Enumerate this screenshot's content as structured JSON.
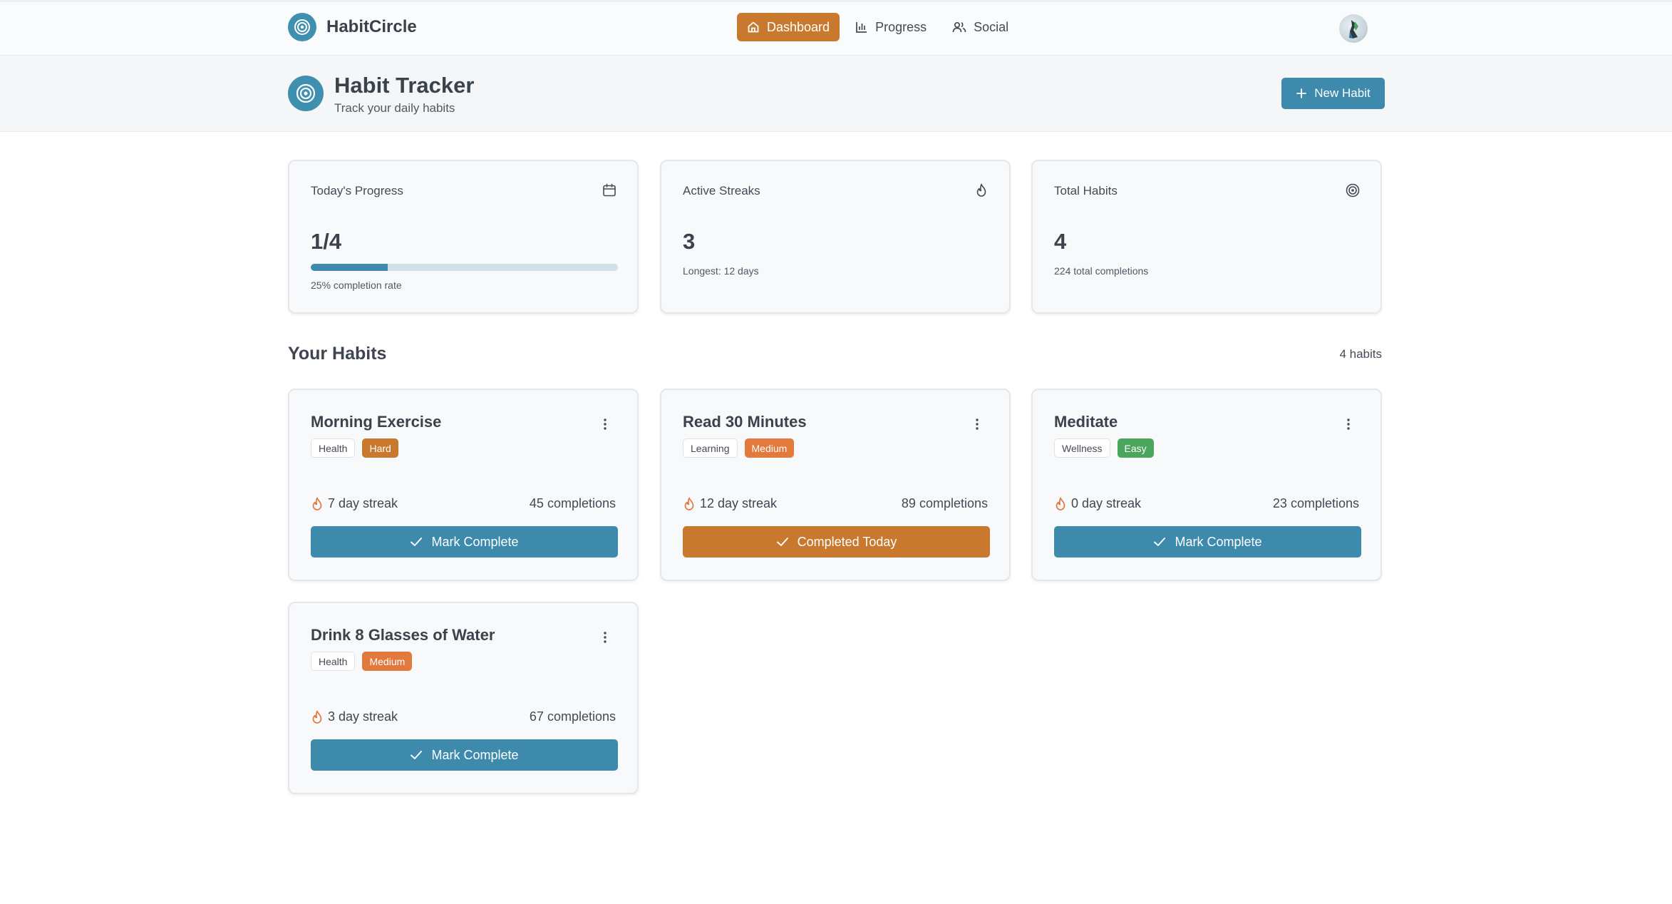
{
  "app": {
    "name": "HabitCircle"
  },
  "nav": {
    "items": [
      {
        "label": "Dashboard",
        "icon": "home-icon",
        "active": true
      },
      {
        "label": "Progress",
        "icon": "bar-chart-icon",
        "active": false
      },
      {
        "label": "Social",
        "icon": "users-icon",
        "active": false
      }
    ]
  },
  "header": {
    "title": "Habit Tracker",
    "subtitle": "Track your daily habits",
    "new_habit_label": "New Habit"
  },
  "stats": {
    "progress": {
      "title": "Today's Progress",
      "value": "1/4",
      "rate": 0.25,
      "sub": "25% completion rate",
      "icon": "calendar-icon"
    },
    "streaks": {
      "title": "Active Streaks",
      "value": "3",
      "sub": "Longest: 12 days",
      "icon": "flame-icon"
    },
    "total": {
      "title": "Total Habits",
      "value": "4",
      "sub": "224 total completions",
      "icon": "target-icon"
    }
  },
  "habits_section": {
    "title": "Your Habits",
    "count": "4 habits"
  },
  "habits": [
    {
      "name": "Morning Exercise",
      "category": "Health",
      "difficulty": "Hard",
      "streak": "7 day streak",
      "completions": "45 completions",
      "action": "Mark Complete",
      "completed": false
    },
    {
      "name": "Read 30 Minutes",
      "category": "Learning",
      "difficulty": "Medium",
      "streak": "12 day streak",
      "completions": "89 completions",
      "action": "Completed Today",
      "completed": true
    },
    {
      "name": "Meditate",
      "category": "Wellness",
      "difficulty": "Easy",
      "streak": "0 day streak",
      "completions": "23 completions",
      "action": "Mark Complete",
      "completed": false
    },
    {
      "name": "Drink 8 Glasses of Water",
      "category": "Health",
      "difficulty": "Medium",
      "streak": "3 day streak",
      "completions": "67 completions",
      "action": "Mark Complete",
      "completed": false
    }
  ],
  "colors": {
    "primary": "#3d8aad",
    "accent": "#c8792e",
    "medium": "#e2793d",
    "easy": "#4aa65c",
    "flame": "#e2793d"
  }
}
